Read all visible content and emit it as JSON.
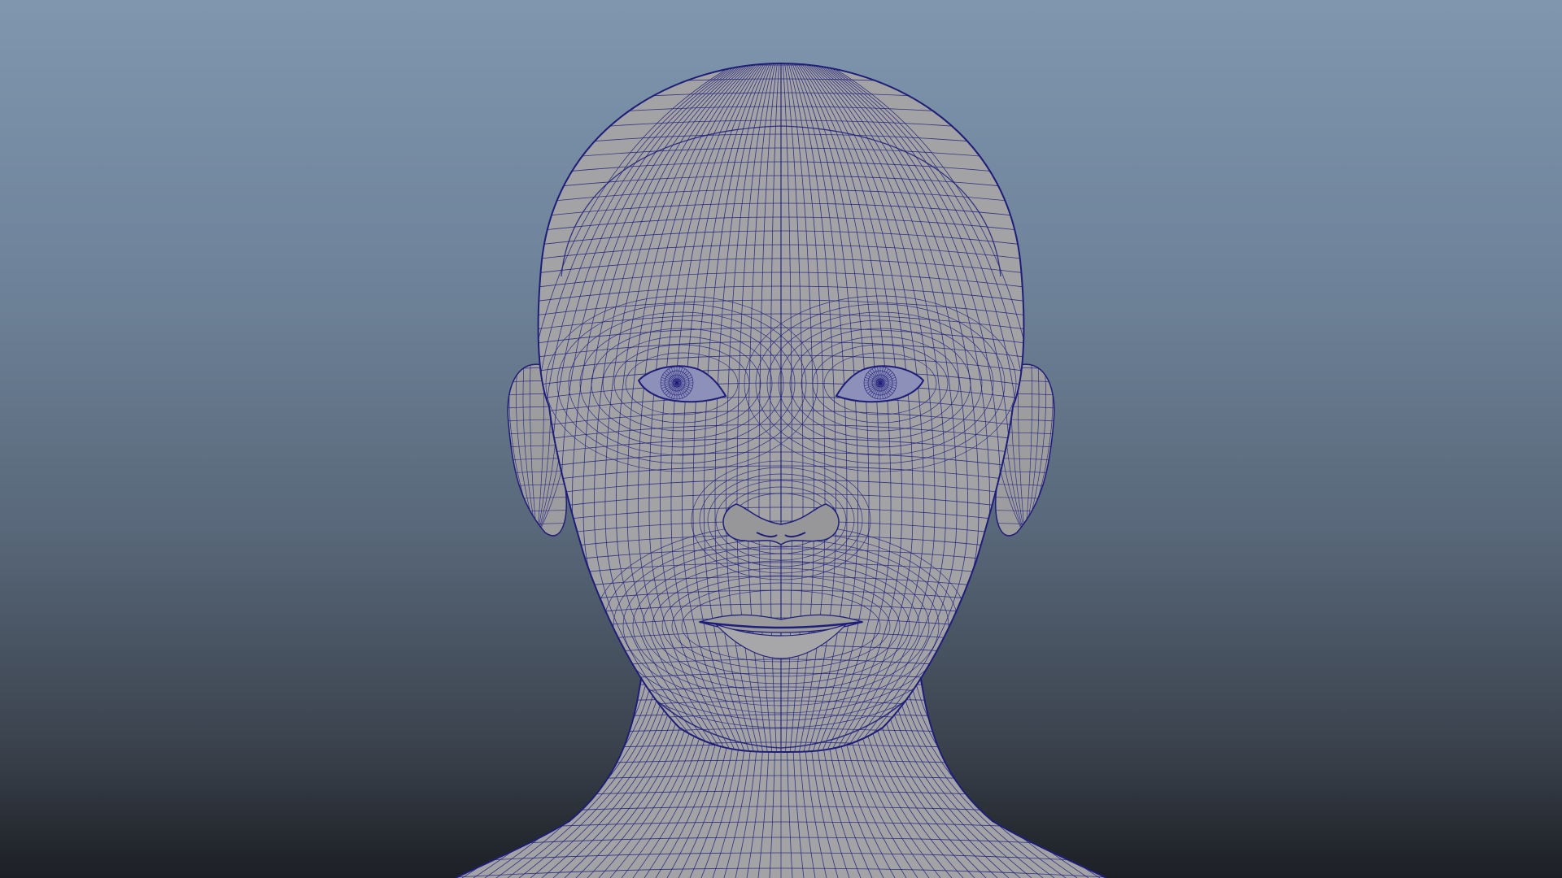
{
  "viewport": {
    "view": "front",
    "shading": "wireframe-on-shaded",
    "subject": "head-mesh"
  },
  "colors": {
    "background_top": "#7f96ae",
    "background_bottom": "#1c1f24",
    "mesh_fill": "#a3a3a6",
    "mesh_wire": "#1e1e7a",
    "eye_fill": "#8d90b8"
  }
}
